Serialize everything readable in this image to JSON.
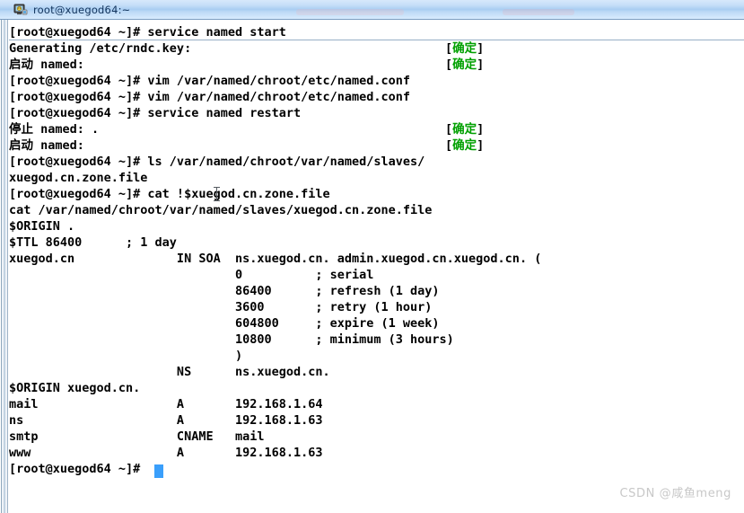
{
  "window": {
    "title": "root@xuegod64:~",
    "icon": "terminal-computer-icon"
  },
  "terminal": {
    "font_color": "#000000",
    "ok_color": "#00a000",
    "background": "#ffffff",
    "cursor_color": "#3a9ffb",
    "lines": [
      {
        "text": "[root@xuegod64 ~]# service named start"
      },
      {
        "text": "Generating /etc/rndc.key:"
      },
      {
        "text": "启动 named:"
      },
      {
        "text": "[root@xuegod64 ~]# vim /var/named/chroot/etc/named.conf"
      },
      {
        "text": "[root@xuegod64 ~]# vim /var/named/chroot/etc/named.conf"
      },
      {
        "text": "[root@xuegod64 ~]# service named restart"
      },
      {
        "text": "停止 named: ."
      },
      {
        "text": "启动 named:"
      },
      {
        "text": "[root@xuegod64 ~]# ls /var/named/chroot/var/named/slaves/"
      },
      {
        "text": "xuegod.cn.zone.file"
      },
      {
        "text": "[root@xuegod64 ~]# cat !$xuegod.cn.zone.file"
      },
      {
        "text": "cat /var/named/chroot/var/named/slaves/xuegod.cn.zone.file"
      },
      {
        "text": "$ORIGIN ."
      },
      {
        "text": "$TTL 86400      ; 1 day"
      },
      {
        "text": "xuegod.cn              IN SOA  ns.xuegod.cn. admin.xuegod.cn.xuegod.cn. ("
      },
      {
        "text": "                               0          ; serial"
      },
      {
        "text": "                               86400      ; refresh (1 day)"
      },
      {
        "text": "                               3600       ; retry (1 hour)"
      },
      {
        "text": "                               604800     ; expire (1 week)"
      },
      {
        "text": "                               10800      ; minimum (3 hours)"
      },
      {
        "text": "                               )"
      },
      {
        "text": "                       NS      ns.xuegod.cn."
      },
      {
        "text": "$ORIGIN xuegod.cn."
      },
      {
        "text": "mail                   A       192.168.1.64"
      },
      {
        "text": "ns                     A       192.168.1.63"
      },
      {
        "text": "smtp                   CNAME   mail"
      },
      {
        "text": "www                    A       192.168.1.63"
      },
      {
        "text": "[root@xuegod64 ~]# "
      }
    ],
    "status_markers": [
      {
        "bracket_open": "[",
        "label": "确定",
        "bracket_close": "]",
        "line_index": 1
      },
      {
        "bracket_open": "[",
        "label": "确定",
        "bracket_close": "]",
        "line_index": 2
      },
      {
        "bracket_open": "[",
        "label": "确定",
        "bracket_close": "]",
        "line_index": 6
      },
      {
        "bracket_open": "[",
        "label": "确定",
        "bracket_close": "]",
        "line_index": 7
      }
    ]
  },
  "watermark": {
    "text": "CSDN @咸鱼meng"
  }
}
